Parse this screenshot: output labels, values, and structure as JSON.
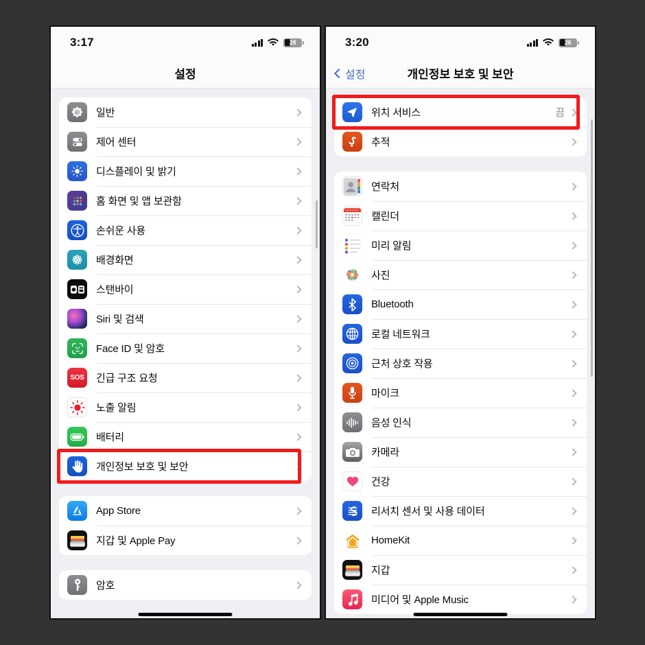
{
  "accent": {
    "red_box": "#f21b1b",
    "ios_blue": "#3b6fd4",
    "bg": "#333333"
  },
  "left_phone": {
    "status": {
      "time": "3:17",
      "battery": "28",
      "signal_icon": "cellular-bars-icon",
      "wifi_icon": "wifi-icon",
      "battery_icon": "battery-icon"
    },
    "nav": {
      "title": "설정"
    },
    "groups": [
      {
        "rows": [
          {
            "label": "일반",
            "icon": "gear-icon",
            "value": ""
          },
          {
            "label": "제어 센터",
            "icon": "control-center-icon",
            "value": ""
          },
          {
            "label": "디스플레이 및 밝기",
            "icon": "brightness-icon",
            "value": ""
          },
          {
            "label": "홈 화면 및 앱 보관함",
            "icon": "home-screen-icon",
            "value": ""
          },
          {
            "label": "손쉬운 사용",
            "icon": "accessibility-icon",
            "value": ""
          },
          {
            "label": "배경화면",
            "icon": "wallpaper-icon",
            "value": ""
          },
          {
            "label": "스탠바이",
            "icon": "standby-icon",
            "value": ""
          },
          {
            "label": "Siri 및 검색",
            "icon": "siri-icon",
            "value": ""
          },
          {
            "label": "Face ID 및 암호",
            "icon": "face-id-icon",
            "value": ""
          },
          {
            "label": "긴급 구조 요청",
            "icon": "sos-icon",
            "value": ""
          },
          {
            "label": "노출 알림",
            "icon": "exposure-notification-icon",
            "value": ""
          },
          {
            "label": "배터리",
            "icon": "battery-settings-icon",
            "value": ""
          },
          {
            "label": "개인정보 보호 및 보안",
            "icon": "privacy-hand-icon",
            "value": ""
          }
        ]
      },
      {
        "rows": [
          {
            "label": "App Store",
            "icon": "app-store-icon",
            "value": ""
          },
          {
            "label": "지갑 및 Apple Pay",
            "icon": "wallet-icon",
            "value": ""
          }
        ]
      },
      {
        "rows": [
          {
            "label": "암호",
            "icon": "passwords-key-icon",
            "value": ""
          }
        ]
      }
    ],
    "highlight_row_label": "개인정보 보호 및 보안"
  },
  "right_phone": {
    "status": {
      "time": "3:20",
      "battery": "26",
      "signal_icon": "cellular-bars-icon",
      "wifi_icon": "wifi-icon",
      "battery_icon": "battery-icon"
    },
    "nav": {
      "back_label": "설정",
      "back_icon": "chevron-left-icon",
      "title": "개인정보 보호 및 보안"
    },
    "groups": [
      {
        "rows": [
          {
            "label": "위치 서비스",
            "icon": "location-arrow-icon",
            "value": "끔"
          },
          {
            "label": "추적",
            "icon": "tracking-icon",
            "value": ""
          }
        ]
      },
      {
        "rows": [
          {
            "label": "연락처",
            "icon": "contacts-icon",
            "value": ""
          },
          {
            "label": "캘린더",
            "icon": "calendar-icon",
            "value": ""
          },
          {
            "label": "미리 알림",
            "icon": "reminders-icon",
            "value": ""
          },
          {
            "label": "사진",
            "icon": "photos-icon",
            "value": ""
          },
          {
            "label": "Bluetooth",
            "icon": "bluetooth-icon",
            "value": ""
          },
          {
            "label": "로컬 네트워크",
            "icon": "local-network-icon",
            "value": ""
          },
          {
            "label": "근처 상호 작용",
            "icon": "nearby-interactions-icon",
            "value": ""
          },
          {
            "label": "마이크",
            "icon": "microphone-icon",
            "value": ""
          },
          {
            "label": "음성 인식",
            "icon": "speech-recognition-icon",
            "value": ""
          },
          {
            "label": "카메라",
            "icon": "camera-icon",
            "value": ""
          },
          {
            "label": "건강",
            "icon": "health-heart-icon",
            "value": ""
          },
          {
            "label": "리서치 센서 및 사용 데이터",
            "icon": "research-sensor-icon",
            "value": ""
          },
          {
            "label": "HomeKit",
            "icon": "homekit-icon",
            "value": ""
          },
          {
            "label": "지갑",
            "icon": "wallet-icon",
            "value": ""
          },
          {
            "label": "미디어 및 Apple Music",
            "icon": "apple-music-icon",
            "value": ""
          }
        ]
      }
    ],
    "highlight_row_label": "위치 서비스"
  }
}
